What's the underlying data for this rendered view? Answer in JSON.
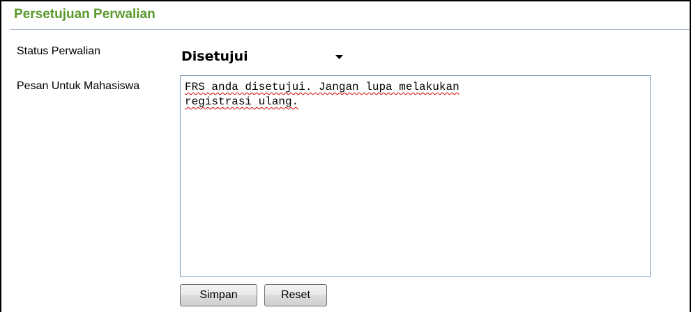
{
  "header": {
    "title": "Persetujuan Perwalian"
  },
  "form": {
    "status_label": "Status Perwalian",
    "status_value": "Disetujui",
    "pesan_label": "Pesan Untuk Mahasiswa",
    "pesan_value": "FRS anda disetujui. Jangan lupa melakukan\nregistrasi ulang."
  },
  "buttons": {
    "save_label": "Simpan",
    "reset_label": "Reset"
  },
  "colors": {
    "title": "#5a9a2c",
    "rule": "#9fb7cc",
    "textarea_border": "#7f9db9",
    "spellcheck": "#d40000"
  },
  "icons": {
    "dropdown": "chevron-down-icon"
  }
}
